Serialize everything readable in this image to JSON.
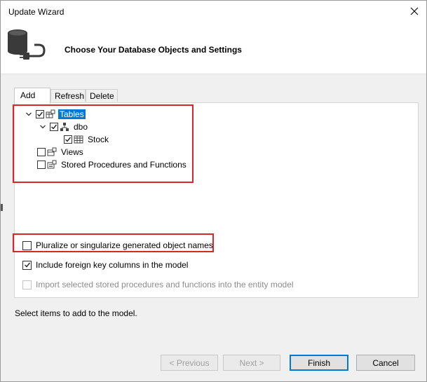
{
  "window": {
    "title": "Update Wizard"
  },
  "banner": {
    "title": "Choose Your Database Objects and Settings"
  },
  "tabs": [
    {
      "label": "Add",
      "active": true
    },
    {
      "label": "Refresh",
      "active": false
    },
    {
      "label": "Delete",
      "active": false
    }
  ],
  "tree": {
    "tables": {
      "label": "Tables",
      "checked": true,
      "expanded": true,
      "selected": true
    },
    "dbo": {
      "label": "dbo",
      "checked": true,
      "expanded": true
    },
    "stock": {
      "label": "Stock",
      "checked": true
    },
    "views": {
      "label": "Views",
      "checked": false
    },
    "procs": {
      "label": "Stored Procedures and Functions",
      "checked": false
    }
  },
  "options": {
    "pluralize": {
      "label": "Pluralize or singularize generated object names",
      "checked": false
    },
    "foreign_keys": {
      "label": "Include foreign key columns in the model",
      "checked": true
    },
    "import_procs": {
      "label": "Import selected stored procedures and functions into the entity model",
      "checked": false,
      "disabled": true
    }
  },
  "status": "Select items to add to the model.",
  "buttons": {
    "previous": "< Previous",
    "next": "Next >",
    "finish": "Finish",
    "cancel": "Cancel"
  },
  "colors": {
    "highlight": "#d62828",
    "selection": "#0078d7"
  }
}
